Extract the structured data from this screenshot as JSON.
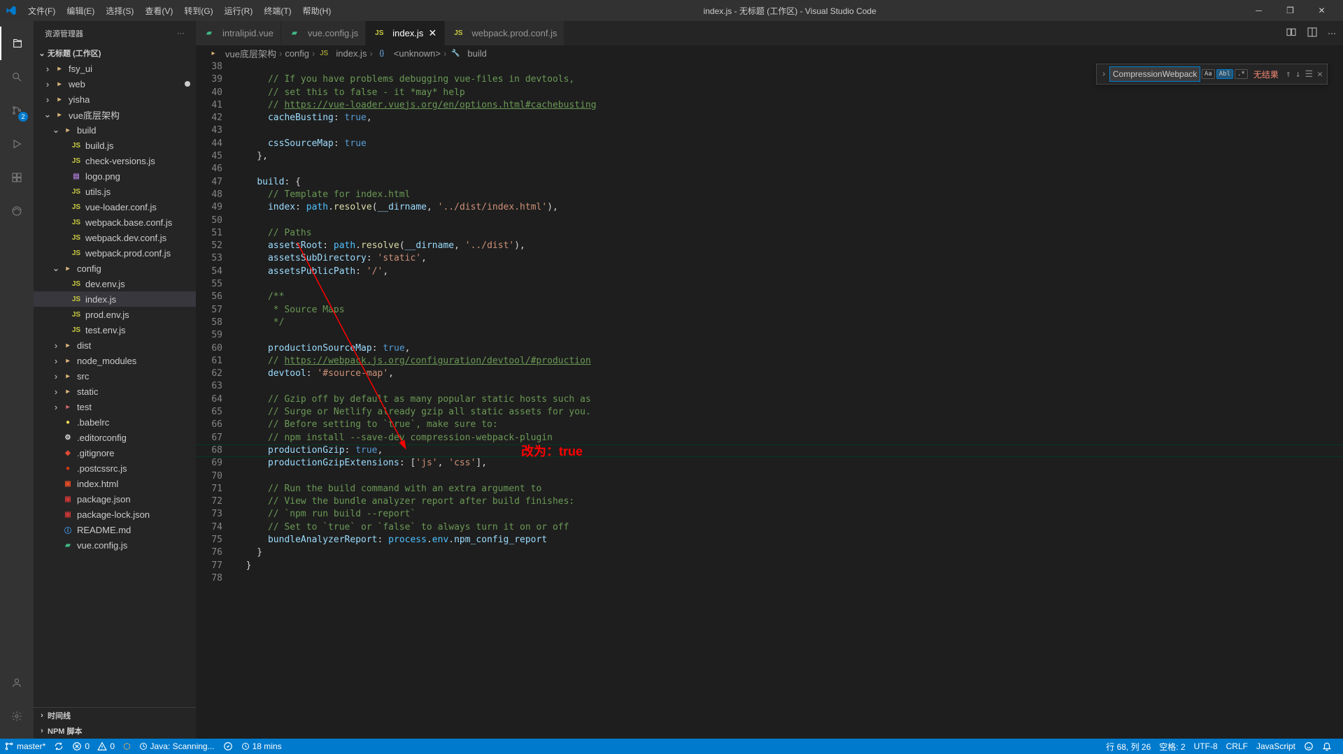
{
  "title": "index.js - 无标题 (工作区) - Visual Studio Code",
  "menu": [
    "文件(F)",
    "编辑(E)",
    "选择(S)",
    "查看(V)",
    "转到(G)",
    "运行(R)",
    "终端(T)",
    "帮助(H)"
  ],
  "sidebar": {
    "title": "资源管理器",
    "workspace": "无标题 (工作区)",
    "tree": [
      {
        "d": 1,
        "t": "f",
        "c": true,
        "i": "folder",
        "n": "fsy_ui"
      },
      {
        "d": 1,
        "t": "f",
        "c": true,
        "i": "folder",
        "n": "web",
        "mod": true
      },
      {
        "d": 1,
        "t": "f",
        "c": true,
        "i": "folder",
        "n": "yisha"
      },
      {
        "d": 1,
        "t": "f",
        "c": false,
        "i": "folder",
        "n": "vue底层架构"
      },
      {
        "d": 2,
        "t": "f",
        "c": false,
        "i": "folder",
        "n": "build"
      },
      {
        "d": 3,
        "t": "file",
        "i": "js",
        "n": "build.js"
      },
      {
        "d": 3,
        "t": "file",
        "i": "js",
        "n": "check-versions.js"
      },
      {
        "d": 3,
        "t": "file",
        "i": "img",
        "n": "logo.png"
      },
      {
        "d": 3,
        "t": "file",
        "i": "js",
        "n": "utils.js"
      },
      {
        "d": 3,
        "t": "file",
        "i": "js",
        "n": "vue-loader.conf.js"
      },
      {
        "d": 3,
        "t": "file",
        "i": "js",
        "n": "webpack.base.conf.js"
      },
      {
        "d": 3,
        "t": "file",
        "i": "js",
        "n": "webpack.dev.conf.js"
      },
      {
        "d": 3,
        "t": "file",
        "i": "js",
        "n": "webpack.prod.conf.js"
      },
      {
        "d": 2,
        "t": "f",
        "c": false,
        "i": "folder",
        "n": "config"
      },
      {
        "d": 3,
        "t": "file",
        "i": "js",
        "n": "dev.env.js"
      },
      {
        "d": 3,
        "t": "file",
        "i": "js",
        "n": "index.js",
        "sel": true
      },
      {
        "d": 3,
        "t": "file",
        "i": "js",
        "n": "prod.env.js"
      },
      {
        "d": 3,
        "t": "file",
        "i": "js",
        "n": "test.env.js"
      },
      {
        "d": 2,
        "t": "f",
        "c": true,
        "i": "folder",
        "n": "dist"
      },
      {
        "d": 2,
        "t": "f",
        "c": true,
        "i": "folder",
        "n": "node_modules"
      },
      {
        "d": 2,
        "t": "f",
        "c": true,
        "i": "folder",
        "n": "src"
      },
      {
        "d": 2,
        "t": "f",
        "c": true,
        "i": "folder",
        "n": "static"
      },
      {
        "d": 2,
        "t": "f",
        "c": true,
        "i": "folder-red",
        "n": "test"
      },
      {
        "d": 2,
        "t": "file",
        "i": "babel",
        "n": ".babelrc"
      },
      {
        "d": 2,
        "t": "file",
        "i": "editor",
        "n": ".editorconfig"
      },
      {
        "d": 2,
        "t": "file",
        "i": "git",
        "n": ".gitignore"
      },
      {
        "d": 2,
        "t": "file",
        "i": "postcss",
        "n": ".postcssrc.js"
      },
      {
        "d": 2,
        "t": "file",
        "i": "html",
        "n": "index.html"
      },
      {
        "d": 2,
        "t": "file",
        "i": "npm",
        "n": "package.json"
      },
      {
        "d": 2,
        "t": "file",
        "i": "npm",
        "n": "package-lock.json"
      },
      {
        "d": 2,
        "t": "file",
        "i": "info",
        "n": "README.md"
      },
      {
        "d": 2,
        "t": "file",
        "i": "vue",
        "n": "vue.config.js"
      }
    ],
    "bottom": [
      "时间线",
      "NPM 脚本"
    ]
  },
  "tabs": [
    {
      "i": "vue",
      "n": "intralipid.vue"
    },
    {
      "i": "vue",
      "n": "vue.config.js"
    },
    {
      "i": "js",
      "n": "index.js",
      "active": true
    },
    {
      "i": "js",
      "n": "webpack.prod.conf.js"
    }
  ],
  "breadcrumb": [
    {
      "i": "folder",
      "l": "vue底层架构"
    },
    {
      "i": "",
      "l": "config"
    },
    {
      "i": "js",
      "l": "index.js"
    },
    {
      "i": "brace",
      "l": "<unknown>"
    },
    {
      "i": "wrench",
      "l": "build"
    }
  ],
  "find": {
    "value": "CompressionWebpackPlugin",
    "result": "无结果",
    "aa": "Aa",
    "ab": "Abl",
    "star": ".*"
  },
  "code": {
    "start": 38,
    "lines": [
      "",
      "    // If you have problems debugging vue-files in devtools,",
      "    // set this to false - it *may* help",
      "    // https://vue-loader.vuejs.org/en/options.html#cachebusting",
      "    cacheBusting: true,",
      "",
      "    cssSourceMap: true",
      "  },",
      "",
      "  build: {",
      "    // Template for index.html",
      "    index: path.resolve(__dirname, '../dist/index.html'),",
      "",
      "    // Paths",
      "    assetsRoot: path.resolve(__dirname, '../dist'),",
      "    assetsSubDirectory: 'static',",
      "    assetsPublicPath: '/',",
      "",
      "    /**",
      "     * Source Maps",
      "     */",
      "",
      "    productionSourceMap: true,",
      "    // https://webpack.js.org/configuration/devtool/#production",
      "    devtool: '#source-map',",
      "",
      "    // Gzip off by default as many popular static hosts such as",
      "    // Surge or Netlify already gzip all static assets for you.",
      "    // Before setting to `true`, make sure to:",
      "    // npm install --save-dev compression-webpack-plugin",
      "    productionGzip: true,",
      "    productionGzipExtensions: ['js', 'css'],",
      "",
      "    // Run the build command with an extra argument to",
      "    // View the bundle analyzer report after build finishes:",
      "    // `npm run build --report`",
      "    // Set to `true` or `false` to always turn it on or off",
      "    bundleAnalyzerReport: process.env.npm_config_report",
      "  }",
      "}",
      ""
    ]
  },
  "annotation_text": "改为：true",
  "scm_badge": "2",
  "status": {
    "branch": "master*",
    "sync": "",
    "errors": "0",
    "warnings": "0",
    "lint": "ESLint",
    "java": "Java: Scanning...",
    "prettier": "",
    "time": "18 mins",
    "pos": "行 68, 列 26",
    "spaces": "空格: 2",
    "enc": "UTF-8",
    "eol": "CRLF",
    "lang": "JavaScript",
    "bell": ""
  }
}
